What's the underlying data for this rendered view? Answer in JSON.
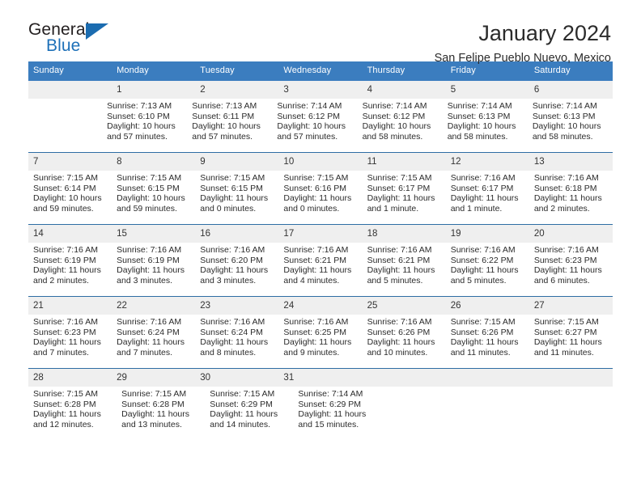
{
  "logo": {
    "word_one": "General",
    "word_two": "Blue",
    "triangle_color": "#1b6cb0"
  },
  "header": {
    "title": "January 2024",
    "subtitle": "San Felipe Pueblo Nuevo, Mexico"
  },
  "theme": {
    "header_blue": "#3b7dbf",
    "divider_blue": "#2e6da4",
    "date_band_gray": "#efefef"
  },
  "calendar": {
    "weekdays": [
      "Sunday",
      "Monday",
      "Tuesday",
      "Wednesday",
      "Thursday",
      "Friday",
      "Saturday"
    ],
    "weeks": [
      [
        {
          "date": "",
          "sunrise": "",
          "sunset": "",
          "daylight": ""
        },
        {
          "date": "1",
          "sunrise": "Sunrise: 7:13 AM",
          "sunset": "Sunset: 6:10 PM",
          "daylight": "Daylight: 10 hours and 57 minutes."
        },
        {
          "date": "2",
          "sunrise": "Sunrise: 7:13 AM",
          "sunset": "Sunset: 6:11 PM",
          "daylight": "Daylight: 10 hours and 57 minutes."
        },
        {
          "date": "3",
          "sunrise": "Sunrise: 7:14 AM",
          "sunset": "Sunset: 6:12 PM",
          "daylight": "Daylight: 10 hours and 57 minutes."
        },
        {
          "date": "4",
          "sunrise": "Sunrise: 7:14 AM",
          "sunset": "Sunset: 6:12 PM",
          "daylight": "Daylight: 10 hours and 58 minutes."
        },
        {
          "date": "5",
          "sunrise": "Sunrise: 7:14 AM",
          "sunset": "Sunset: 6:13 PM",
          "daylight": "Daylight: 10 hours and 58 minutes."
        },
        {
          "date": "6",
          "sunrise": "Sunrise: 7:14 AM",
          "sunset": "Sunset: 6:13 PM",
          "daylight": "Daylight: 10 hours and 58 minutes."
        }
      ],
      [
        {
          "date": "7",
          "sunrise": "Sunrise: 7:15 AM",
          "sunset": "Sunset: 6:14 PM",
          "daylight": "Daylight: 10 hours and 59 minutes."
        },
        {
          "date": "8",
          "sunrise": "Sunrise: 7:15 AM",
          "sunset": "Sunset: 6:15 PM",
          "daylight": "Daylight: 10 hours and 59 minutes."
        },
        {
          "date": "9",
          "sunrise": "Sunrise: 7:15 AM",
          "sunset": "Sunset: 6:15 PM",
          "daylight": "Daylight: 11 hours and 0 minutes."
        },
        {
          "date": "10",
          "sunrise": "Sunrise: 7:15 AM",
          "sunset": "Sunset: 6:16 PM",
          "daylight": "Daylight: 11 hours and 0 minutes."
        },
        {
          "date": "11",
          "sunrise": "Sunrise: 7:15 AM",
          "sunset": "Sunset: 6:17 PM",
          "daylight": "Daylight: 11 hours and 1 minute."
        },
        {
          "date": "12",
          "sunrise": "Sunrise: 7:16 AM",
          "sunset": "Sunset: 6:17 PM",
          "daylight": "Daylight: 11 hours and 1 minute."
        },
        {
          "date": "13",
          "sunrise": "Sunrise: 7:16 AM",
          "sunset": "Sunset: 6:18 PM",
          "daylight": "Daylight: 11 hours and 2 minutes."
        }
      ],
      [
        {
          "date": "14",
          "sunrise": "Sunrise: 7:16 AM",
          "sunset": "Sunset: 6:19 PM",
          "daylight": "Daylight: 11 hours and 2 minutes."
        },
        {
          "date": "15",
          "sunrise": "Sunrise: 7:16 AM",
          "sunset": "Sunset: 6:19 PM",
          "daylight": "Daylight: 11 hours and 3 minutes."
        },
        {
          "date": "16",
          "sunrise": "Sunrise: 7:16 AM",
          "sunset": "Sunset: 6:20 PM",
          "daylight": "Daylight: 11 hours and 3 minutes."
        },
        {
          "date": "17",
          "sunrise": "Sunrise: 7:16 AM",
          "sunset": "Sunset: 6:21 PM",
          "daylight": "Daylight: 11 hours and 4 minutes."
        },
        {
          "date": "18",
          "sunrise": "Sunrise: 7:16 AM",
          "sunset": "Sunset: 6:21 PM",
          "daylight": "Daylight: 11 hours and 5 minutes."
        },
        {
          "date": "19",
          "sunrise": "Sunrise: 7:16 AM",
          "sunset": "Sunset: 6:22 PM",
          "daylight": "Daylight: 11 hours and 5 minutes."
        },
        {
          "date": "20",
          "sunrise": "Sunrise: 7:16 AM",
          "sunset": "Sunset: 6:23 PM",
          "daylight": "Daylight: 11 hours and 6 minutes."
        }
      ],
      [
        {
          "date": "21",
          "sunrise": "Sunrise: 7:16 AM",
          "sunset": "Sunset: 6:23 PM",
          "daylight": "Daylight: 11 hours and 7 minutes."
        },
        {
          "date": "22",
          "sunrise": "Sunrise: 7:16 AM",
          "sunset": "Sunset: 6:24 PM",
          "daylight": "Daylight: 11 hours and 7 minutes."
        },
        {
          "date": "23",
          "sunrise": "Sunrise: 7:16 AM",
          "sunset": "Sunset: 6:24 PM",
          "daylight": "Daylight: 11 hours and 8 minutes."
        },
        {
          "date": "24",
          "sunrise": "Sunrise: 7:16 AM",
          "sunset": "Sunset: 6:25 PM",
          "daylight": "Daylight: 11 hours and 9 minutes."
        },
        {
          "date": "25",
          "sunrise": "Sunrise: 7:16 AM",
          "sunset": "Sunset: 6:26 PM",
          "daylight": "Daylight: 11 hours and 10 minutes."
        },
        {
          "date": "26",
          "sunrise": "Sunrise: 7:15 AM",
          "sunset": "Sunset: 6:26 PM",
          "daylight": "Daylight: 11 hours and 11 minutes."
        },
        {
          "date": "27",
          "sunrise": "Sunrise: 7:15 AM",
          "sunset": "Sunset: 6:27 PM",
          "daylight": "Daylight: 11 hours and 11 minutes."
        }
      ],
      [
        {
          "date": "28",
          "sunrise": "Sunrise: 7:15 AM",
          "sunset": "Sunset: 6:28 PM",
          "daylight": "Daylight: 11 hours and 12 minutes."
        },
        {
          "date": "29",
          "sunrise": "Sunrise: 7:15 AM",
          "sunset": "Sunset: 6:28 PM",
          "daylight": "Daylight: 11 hours and 13 minutes."
        },
        {
          "date": "30",
          "sunrise": "Sunrise: 7:15 AM",
          "sunset": "Sunset: 6:29 PM",
          "daylight": "Daylight: 11 hours and 14 minutes."
        },
        {
          "date": "31",
          "sunrise": "Sunrise: 7:14 AM",
          "sunset": "Sunset: 6:29 PM",
          "daylight": "Daylight: 11 hours and 15 minutes."
        },
        {
          "date": "",
          "sunrise": "",
          "sunset": "",
          "daylight": ""
        },
        {
          "date": "",
          "sunrise": "",
          "sunset": "",
          "daylight": ""
        },
        {
          "date": "",
          "sunrise": "",
          "sunset": "",
          "daylight": ""
        }
      ]
    ]
  }
}
